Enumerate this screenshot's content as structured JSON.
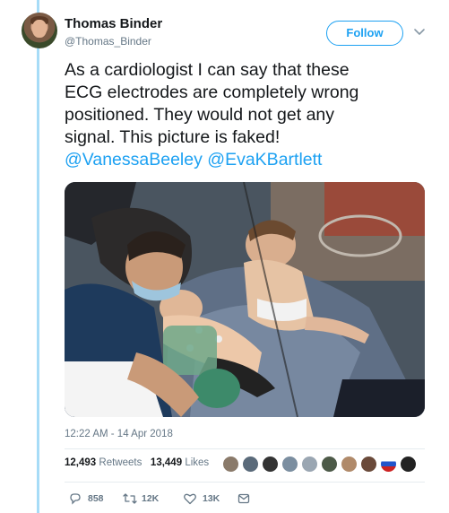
{
  "tweet": {
    "author": {
      "display_name": "Thomas Binder",
      "handle": "@Thomas_Binder"
    },
    "follow_label": "Follow",
    "text_lines": [
      "As a cardiologist I can say that these",
      "ECG electrodes are completely wrong",
      "positioned. They would not get any",
      "signal. This picture is faked!"
    ],
    "mentions": [
      "@VanessaBeeley",
      "@EvaKBartlett"
    ],
    "timestamp": "12:22 AM - 14 Apr 2018",
    "retweets": {
      "count": "12,493",
      "label": "Retweets"
    },
    "likes": {
      "count": "13,449",
      "label": "Likes"
    },
    "actions": {
      "reply_count": "858",
      "retweet_count": "12K",
      "like_count": "13K"
    }
  },
  "colors": {
    "accent": "#1da1f2",
    "thread_line": "#a7dcf7",
    "muted": "#657786"
  },
  "icons": [
    "chevron-down-icon",
    "reply-icon",
    "retweet-icon",
    "like-icon",
    "dm-icon"
  ]
}
